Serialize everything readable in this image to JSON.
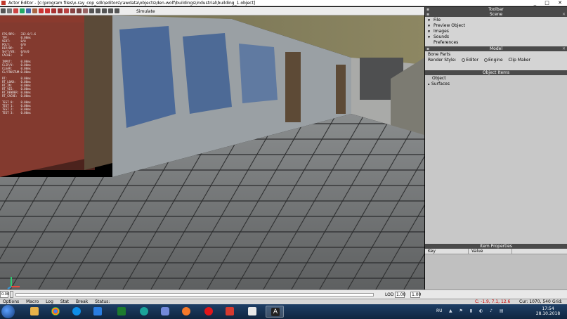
{
  "window": {
    "title": "Actor Editor - [c:\\program files\\x-ray_cop_sdk\\editors\\rawdata\\objects\\den-wolf\\buildings\\industrial\\building_1.object]",
    "controls": "_ □ ✕"
  },
  "toolbar": {
    "items": [
      "U",
      "T",
      "Y",
      "Z",
      "Zc",
      "B",
      "F",
      "B",
      "A",
      "L",
      "R",
      "T",
      "Zz",
      "P",
      "A",
      "F",
      "B",
      "T",
      "Z"
    ],
    "letters": "F B F L B T S",
    "simulate": "Simulate"
  },
  "stats": [
    "FPS/RPS:   332.0/1.6",
    "TPF:       0.00ms",
    "VERT:      0/0",
    "POLY:      0/0",
    "DIP/DP:    0",
    "SH/T/VB:   0/0/0",
    "CACHE:     0",
    "",
    "INPUT:     0.00ms",
    "CLIP/V:    0.00ms",
    "CLEAR:     0.00ms",
    "CL/FRUSTUM:0.00ms",
    "",
    "RT:        0.00ms",
    "RT_LOAD:   0.00ms",
    "RT_IN:     0.00ms",
    "RT_VIS:    0.00ms",
    "RT_RENDER: 0.00ms",
    "RT_CACHE:  0.00ms",
    "",
    "TEST 0:    0.00ms",
    "TEST 1:    0.00ms",
    "TEST 2:    0.00ms",
    "TEST 3:    0.00ms"
  ],
  "panel": {
    "toolbar_title": "Toolbar",
    "scene_title": "Scene",
    "scene_items": [
      "File",
      "Preview Object",
      "Images",
      "Sounds",
      "Preferences"
    ],
    "model_title": "Model",
    "bone_parts": "Bone Parts",
    "render_style_label": "Render Style:",
    "render_editor": "Editor",
    "render_engine": "Engine",
    "clip_maker": "Clip Maker",
    "object_items_title": "Object Items",
    "object_items": [
      "Object",
      "Surfaces"
    ],
    "item_properties_title": "Item Properties",
    "ip_key": "Key",
    "ip_value": "Value"
  },
  "statusrow": {
    "field1": "0.00",
    "field2": "",
    "lod_label": "LOD",
    "lod_value": "1.00",
    "lod_value2": "1.00"
  },
  "statusbar": {
    "items": [
      "Options",
      "Macro",
      "Log",
      "Stat",
      "Break",
      "Status:"
    ],
    "coords": "C: -1.9, 7.1, 12.6",
    "cursor": "Cur: 1070, 540",
    "grid": "Grid: 1.0"
  },
  "taskbar": {
    "lang": "RU",
    "time": "17:54",
    "date": "28.10.2018"
  }
}
